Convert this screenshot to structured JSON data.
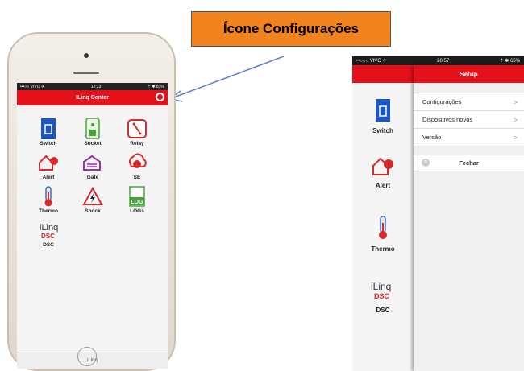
{
  "callout": {
    "text": "Ícone Configurações"
  },
  "left_phone": {
    "status_left": "•••○○ VIVO ✈",
    "status_time": "12:23",
    "status_right": "⇡ ✱ 83%",
    "title": "ILinq Center",
    "tiles": [
      {
        "label": "Switch",
        "icon": "switch-icon"
      },
      {
        "label": "Socket",
        "icon": "socket-icon"
      },
      {
        "label": "Relay",
        "icon": "relay-icon"
      },
      {
        "label": "Alert",
        "icon": "alert-icon"
      },
      {
        "label": "Gate",
        "icon": "gate-icon"
      },
      {
        "label": "SE",
        "icon": "se-icon"
      },
      {
        "label": "Thermo",
        "icon": "thermo-icon"
      },
      {
        "label": "Shock",
        "icon": "shock-icon"
      },
      {
        "label": "LOGs",
        "icon": "logs-icon"
      },
      {
        "label": "DSC",
        "icon": "dsc-icon"
      }
    ],
    "footer_logo": "iLinq"
  },
  "right_phone": {
    "status_left": "••○○○ VIVO ✈",
    "status_time": "20:57",
    "status_right": "⇡ ✱ 65%",
    "side_tiles": [
      {
        "label": "Switch"
      },
      {
        "label": "Alert"
      },
      {
        "label": "Thermo"
      },
      {
        "label": "DSC"
      }
    ],
    "menu_title": "Setup",
    "menu_items": [
      {
        "label": "Configurações"
      },
      {
        "label": "Dispositivos novos"
      },
      {
        "label": "Versão"
      }
    ],
    "close_label": "Fechar"
  },
  "colors": {
    "brand_red": "#e4111b",
    "callout_orange": "#f0831e",
    "arrow_blue": "#5b84c4"
  }
}
